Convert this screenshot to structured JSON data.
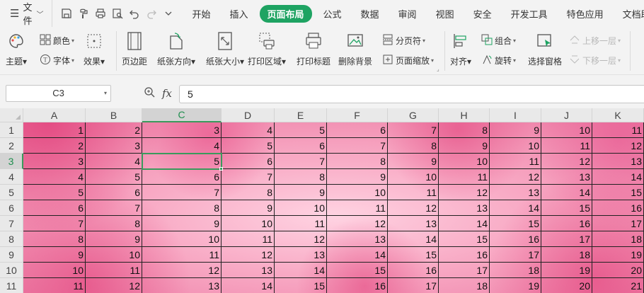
{
  "menubar": {
    "file_label": "文件",
    "tabs": [
      {
        "label": "开始",
        "active": false
      },
      {
        "label": "插入",
        "active": false
      },
      {
        "label": "页面布局",
        "active": true
      },
      {
        "label": "公式",
        "active": false
      },
      {
        "label": "数据",
        "active": false
      },
      {
        "label": "审阅",
        "active": false
      },
      {
        "label": "视图",
        "active": false
      },
      {
        "label": "安全",
        "active": false
      },
      {
        "label": "开发工具",
        "active": false
      },
      {
        "label": "特色应用",
        "active": false
      },
      {
        "label": "文档助手",
        "active": false
      }
    ],
    "accent_color": "#1ea362"
  },
  "ribbon": {
    "theme_colors": "颜色",
    "theme": "主题",
    "fonts": "字体",
    "effects": "效果",
    "margins": "页边距",
    "orientation": "纸张方向",
    "size": "纸张大小",
    "print_area": "打印区域",
    "print_titles": "打印标题",
    "delete_bg": "删除背景",
    "page_break": "分页符",
    "page_zoom": "页面缩放",
    "align": "对齐",
    "group": "组合",
    "rotate": "旋转",
    "selection_pane": "选择窗格",
    "bring_forward": "上移一层",
    "send_backward": "下移一层"
  },
  "formula": {
    "name_box": "C3",
    "fx": "fx",
    "value": "5"
  },
  "sheet": {
    "columns": [
      "A",
      "B",
      "C",
      "D",
      "E",
      "F",
      "G",
      "H",
      "I",
      "J",
      "K"
    ],
    "rows": [
      "1",
      "2",
      "3",
      "4",
      "5",
      "6",
      "7",
      "8",
      "9",
      "10",
      "11"
    ],
    "selected_cell": "C3",
    "cells": [
      [
        "1",
        "2",
        "3",
        "4",
        "5",
        "6",
        "7",
        "8",
        "9",
        "10",
        "11"
      ],
      [
        "2",
        "3",
        "4",
        "5",
        "6",
        "7",
        "8",
        "9",
        "10",
        "11",
        "12"
      ],
      [
        "3",
        "4",
        "5",
        "6",
        "7",
        "8",
        "9",
        "10",
        "11",
        "12",
        "13"
      ],
      [
        "4",
        "5",
        "6",
        "7",
        "8",
        "9",
        "10",
        "11",
        "12",
        "13",
        "14"
      ],
      [
        "5",
        "6",
        "7",
        "8",
        "9",
        "10",
        "11",
        "12",
        "13",
        "14",
        "15"
      ],
      [
        "6",
        "7",
        "8",
        "9",
        "10",
        "11",
        "12",
        "13",
        "14",
        "15",
        "16"
      ],
      [
        "7",
        "8",
        "9",
        "10",
        "11",
        "12",
        "13",
        "14",
        "15",
        "16",
        "17"
      ],
      [
        "8",
        "9",
        "10",
        "11",
        "12",
        "13",
        "14",
        "15",
        "16",
        "17",
        "18"
      ],
      [
        "9",
        "10",
        "11",
        "12",
        "13",
        "14",
        "15",
        "16",
        "17",
        "18",
        "19"
      ],
      [
        "10",
        "11",
        "12",
        "13",
        "14",
        "15",
        "16",
        "17",
        "18",
        "19",
        "20"
      ],
      [
        "11",
        "12",
        "13",
        "14",
        "15",
        "16",
        "17",
        "18",
        "19",
        "20",
        "21"
      ]
    ]
  }
}
